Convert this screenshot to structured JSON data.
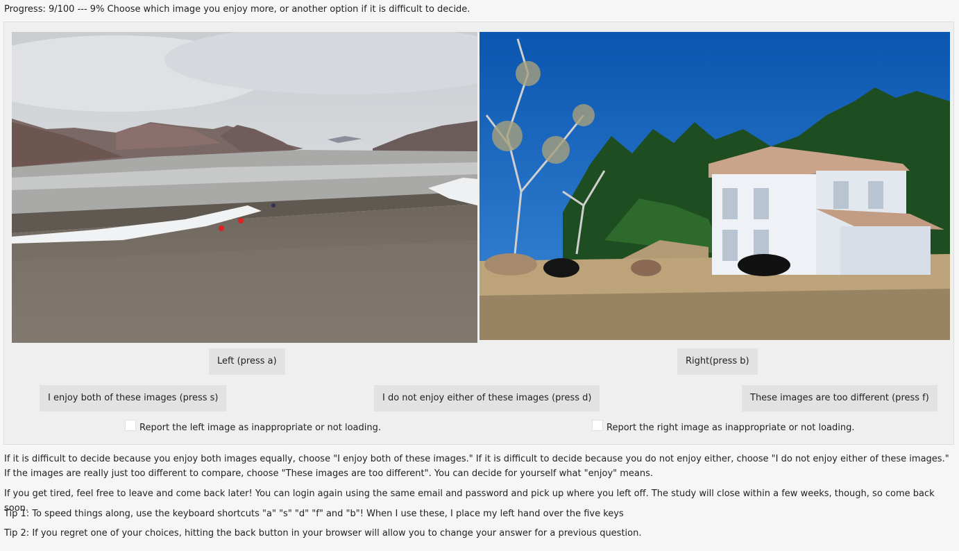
{
  "header": {
    "progress_text": "Progress: 9/100 --- 9% Choose which image you enjoy more, or another option if it is difficult to decide."
  },
  "images": {
    "left_icon": "landscape-photo",
    "right_icon": "farmhouse-photo"
  },
  "buttons": {
    "left": "Left (press a)",
    "right": "Right(press b)",
    "both": "I enjoy both of these images (press s)",
    "neither": "I do not enjoy either of these images (press d)",
    "different": "These images are too different (press f)"
  },
  "reports": {
    "left": "Report the left image as inappropriate or not loading.",
    "right": "Report the right image as inappropriate or not loading."
  },
  "instructions": {
    "p1": "If it is difficult to decide because you enjoy both images equally, choose \"I enjoy both of these images.\" If it is difficult to decide because you do not enjoy either, choose \"I do not enjoy either of these images.\" If the images are really just too different to compare, choose \"These images are too different\". You can decide for yourself what \"enjoy\" means.",
    "p2": "If you get tired, feel free to leave and come back later! You can login again using the same email and password and pick up where you left off. The study will close within a few weeks, though, so come back soon.",
    "tip1": "Tip 1: To speed things along, use the keyboard shortcuts \"a\" \"s\" \"d\" \"f\" and \"b\"! When I use these, I place my left hand over the five keys",
    "tip2": "Tip 2: If you regret one of your choices, hitting the back button in your browser will allow you to change your answer for a previous question."
  },
  "colors": {
    "page_bg": "#f6f6f6",
    "panel_bg": "#efefef",
    "button_bg": "#e2e2e2"
  }
}
